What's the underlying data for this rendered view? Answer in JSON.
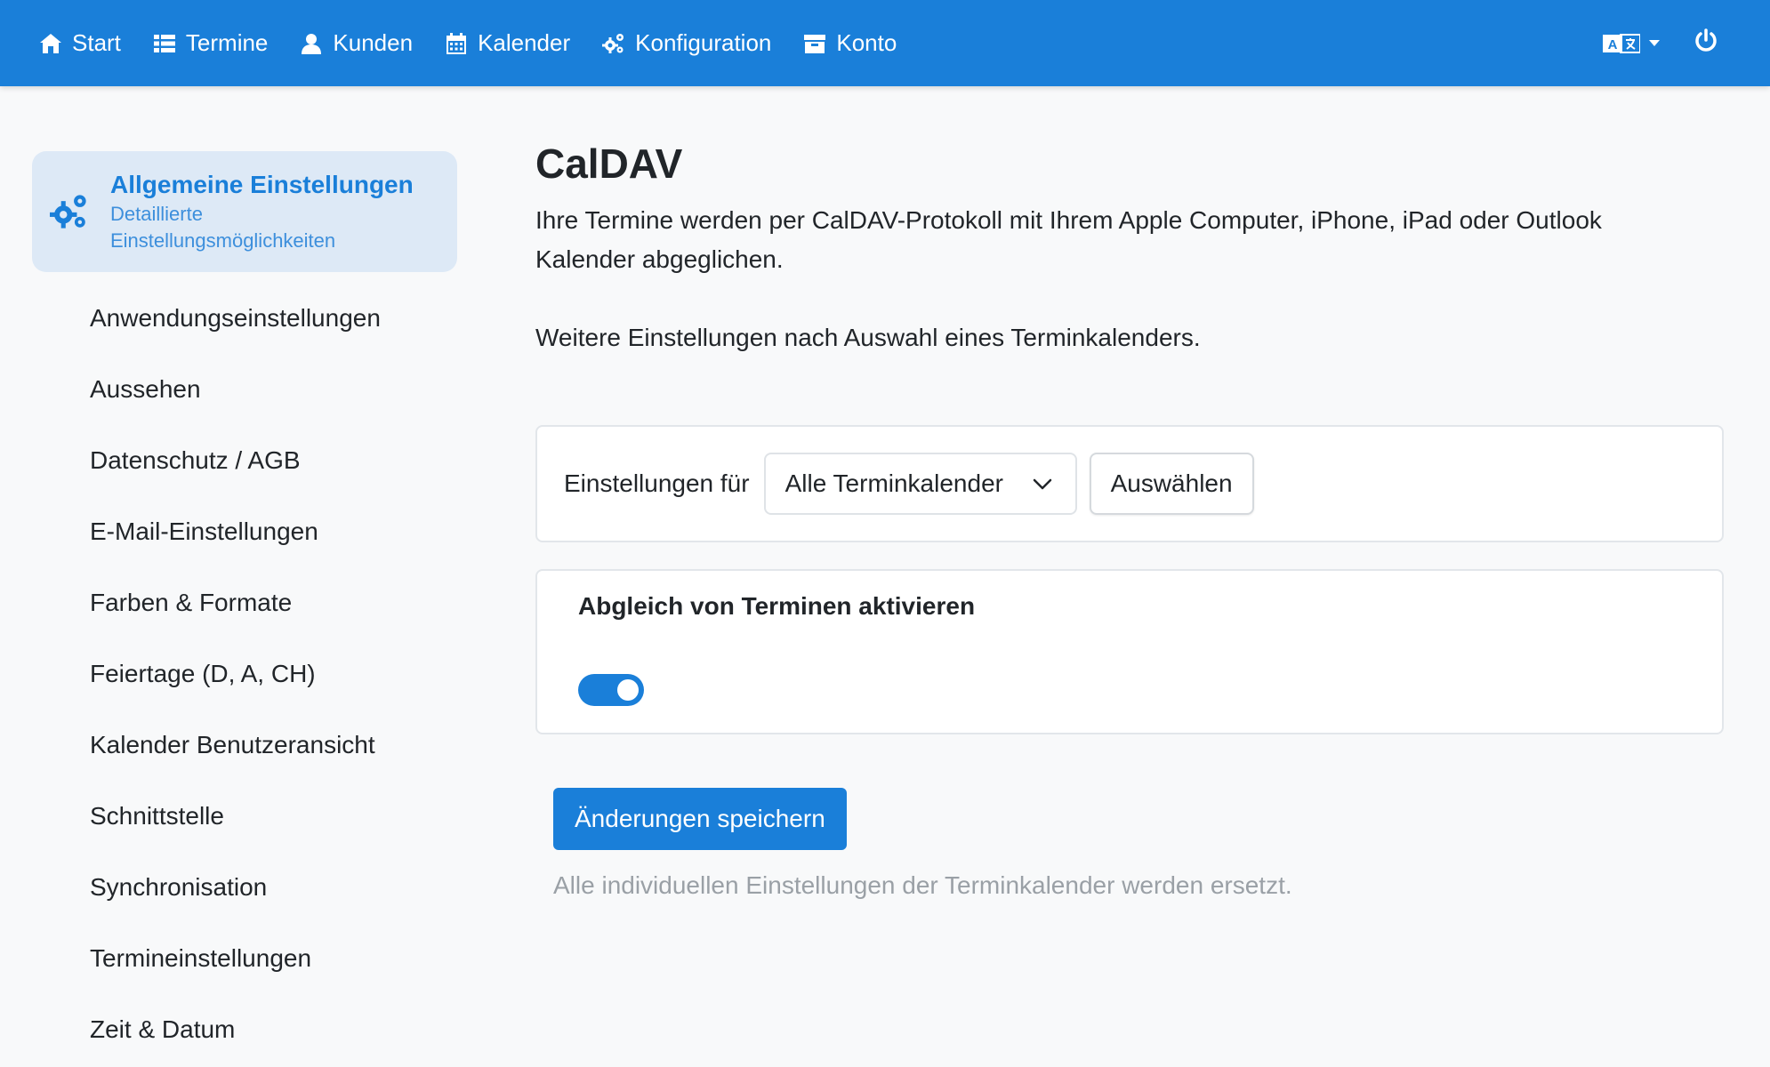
{
  "nav": {
    "items": [
      {
        "label": "Start",
        "icon": "home-icon"
      },
      {
        "label": "Termine",
        "icon": "list-icon"
      },
      {
        "label": "Kunden",
        "icon": "user-icon"
      },
      {
        "label": "Kalender",
        "icon": "calendar-icon"
      },
      {
        "label": "Konfiguration",
        "icon": "cogs-icon"
      },
      {
        "label": "Konto",
        "icon": "archive-icon"
      }
    ],
    "language_icon": "translate-icon",
    "power_icon": "power-icon",
    "brand_color": "#1a7fd9"
  },
  "sidebar": {
    "active": {
      "title": "Allgemeine Einstellungen",
      "subtitle": "Detaillierte Einstellungsmöglichkeiten",
      "icon": "cogs-icon"
    },
    "items": [
      "Anwendungseinstellungen",
      "Aussehen",
      "Datenschutz / AGB",
      "E-Mail-Einstellungen",
      "Farben & Formate",
      "Feiertage (D, A, CH)",
      "Kalender Benutzeransicht",
      "Schnittstelle",
      "Synchronisation",
      "Termineinstellungen",
      "Zeit & Datum"
    ]
  },
  "main": {
    "title": "CalDAV",
    "description": "Ihre Termine werden per CalDAV-Protokoll mit Ihrem Apple Computer, iPhone, iPad oder Outlook Kalender abgeglichen.",
    "description2": "Weitere Einstellungen nach Auswahl eines Terminkalenders.",
    "settings_for_label": "Einstellungen für",
    "calendar_select_value": "Alle Terminkalender",
    "select_button": "Auswählen",
    "sync_heading": "Abgleich von Terminen aktivieren",
    "sync_enabled": true,
    "save_button": "Änderungen speichern",
    "save_hint": "Alle individuellen Einstellungen der Terminkalender werden ersetzt."
  }
}
